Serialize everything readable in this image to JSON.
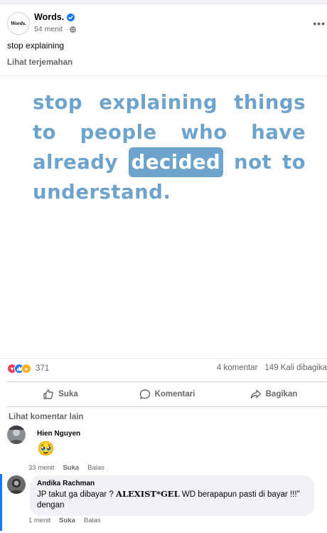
{
  "post": {
    "page_name": "Words.",
    "avatar_text": "Words.",
    "time": "54 menit",
    "separator": "·",
    "caption": "stop explaining",
    "translate": "Lihat terjemahan",
    "image_quote": {
      "line1": [
        "stop",
        "explaining",
        "things"
      ],
      "line2": [
        "to",
        "people",
        "who",
        "have"
      ],
      "line3_before": "already",
      "line3_highlight": "decided",
      "line3_after": [
        "not",
        "to"
      ],
      "line4": "understand."
    },
    "accent_color": "#6ea3cc"
  },
  "stats": {
    "reaction_count": "371",
    "comments": "4 komentar",
    "shares": "149 Kali dibagika"
  },
  "actions": {
    "like": "Suka",
    "comment": "Komentari",
    "share": "Bagikan"
  },
  "comments_section": {
    "see_more": "Lihat komentar lain",
    "items": [
      {
        "name": "Hien Nguyen",
        "text": "🥹",
        "time": "33 menit",
        "like": "Suka",
        "reply": "Balas"
      },
      {
        "name": "Andika Rachman",
        "text_before": "JP takut ga dibayar ? ",
        "text_bold": "ALEXIST*GEL",
        "text_after": " WD berapapun pasti di bayar !!!\"",
        "text_line2": "dengan",
        "time": "1 menit",
        "like": "Suka",
        "reply": "Balas"
      }
    ]
  }
}
